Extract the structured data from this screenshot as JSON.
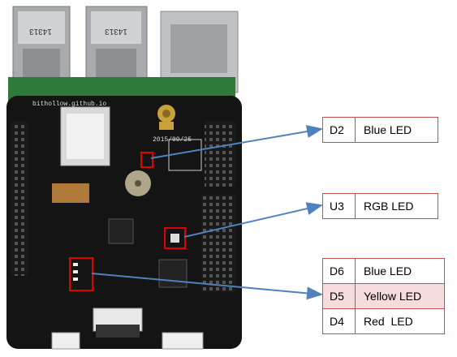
{
  "board": {
    "site_text": "bithollow.github.io",
    "date_text": "2015/09/25",
    "usb_label_left": "14313",
    "usb_label_right": "14313"
  },
  "callouts": {
    "d2": {
      "ref": "D2",
      "desc": "Blue LED"
    },
    "u3": {
      "ref": "U3",
      "desc": "RGB LED"
    },
    "group": [
      {
        "ref": "D6",
        "desc": "Blue LED"
      },
      {
        "ref": "D5",
        "desc": "Yellow LED"
      },
      {
        "ref": "D4",
        "desc": "Red  LED"
      }
    ]
  },
  "colors": {
    "arrow": "#4f81bd",
    "highlight_box": "#e00000",
    "table_border": "#c0504d",
    "table_highlight": "#f6dcdc"
  }
}
